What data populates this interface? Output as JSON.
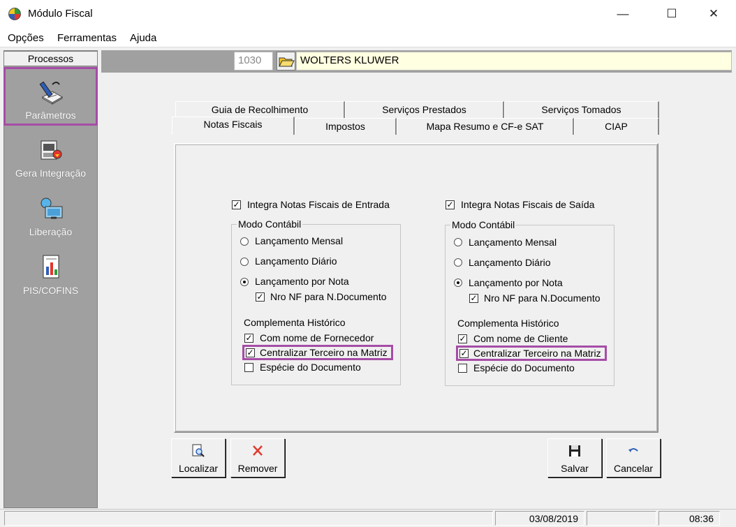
{
  "window": {
    "title": "Módulo Fiscal",
    "minimize": "—",
    "maximize": "☐",
    "close": "✕"
  },
  "menu": [
    "Opções",
    "Ferramentas",
    "Ajuda"
  ],
  "sidebar": {
    "header": "Processos",
    "items": [
      {
        "label": "Parâmetros",
        "icon": "parameters-icon",
        "selected": true
      },
      {
        "label": "Gera Integração",
        "icon": "integration-icon"
      },
      {
        "label": "Liberação",
        "icon": "release-icon"
      },
      {
        "label": "PIS/COFINS",
        "icon": "pis-cofins-icon"
      }
    ]
  },
  "company": {
    "code": "1030",
    "name": "WOLTERS KLUWER"
  },
  "tabs_row1": [
    "Guia de Recolhimento",
    "Serviços Prestados",
    "Serviços Tomados"
  ],
  "tabs_row2": [
    "Notas Fiscais",
    "Impostos",
    "Mapa Resumo e CF-e SAT",
    "CIAP"
  ],
  "active_tab": "Notas Fiscais",
  "entrada": {
    "integra_label": "Integra Notas Fiscais de Entrada",
    "integra_checked": true,
    "modo_title": "Modo Contábil",
    "radios": [
      "Lançamento Mensal",
      "Lançamento Diário",
      "Lançamento por Nota"
    ],
    "selected_radio": 2,
    "nro_nf_label": "Nro NF para N.Documento",
    "nro_nf_checked": true,
    "complementa_title": "Complementa Histórico",
    "comp": [
      {
        "label": "Com nome de Fornecedor",
        "checked": true
      },
      {
        "label": "Centralizar Terceiro na Matriz",
        "checked": true
      },
      {
        "label": "Espécie do Documento",
        "checked": false
      }
    ]
  },
  "saida": {
    "integra_label": "Integra Notas Fiscais de Saída",
    "integra_checked": true,
    "modo_title": "Modo Contábil",
    "radios": [
      "Lançamento Mensal",
      "Lançamento Diário",
      "Lançamento por Nota"
    ],
    "selected_radio": 2,
    "nro_nf_label": "Nro NF para N.Documento",
    "nro_nf_checked": true,
    "complementa_title": "Complementa Histórico",
    "comp": [
      {
        "label": "Com nome de Cliente",
        "checked": true
      },
      {
        "label": "Centralizar Terceiro na Matriz",
        "checked": true
      },
      {
        "label": "Espécie do Documento",
        "checked": false
      }
    ]
  },
  "buttons": {
    "localizar": "Localizar",
    "remover": "Remover",
    "salvar": "Salvar",
    "cancelar": "Cancelar"
  },
  "status": {
    "date": "03/08/2019",
    "time": "08:36"
  },
  "colors": {
    "highlight": "#a64ca6",
    "sidebar": "#a0a0a0",
    "company_bg": "#ffffe1"
  }
}
